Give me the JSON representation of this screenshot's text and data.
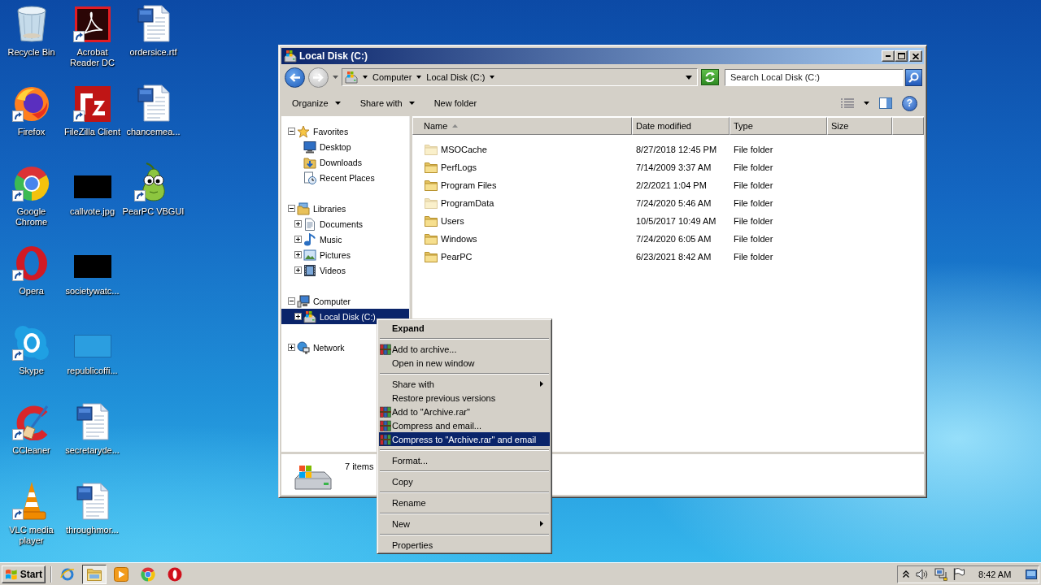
{
  "desktop": {
    "icons": [
      {
        "label": "Recycle Bin",
        "kind": "recycle-bin",
        "shortcut": false,
        "selected": false
      },
      {
        "label": "Firefox",
        "kind": "firefox",
        "shortcut": true,
        "selected": false
      },
      {
        "label": "Google Chrome",
        "kind": "chrome",
        "shortcut": true,
        "selected": false
      },
      {
        "label": "Opera",
        "kind": "opera",
        "shortcut": true,
        "selected": false
      },
      {
        "label": "Skype",
        "kind": "skype",
        "shortcut": true,
        "selected": false
      },
      {
        "label": "CCleaner",
        "kind": "ccleaner",
        "shortcut": true,
        "selected": false
      },
      {
        "label": "VLC media player",
        "kind": "vlc",
        "shortcut": true,
        "selected": false
      },
      {
        "label": "Acrobat Reader DC",
        "kind": "acrobat",
        "shortcut": true,
        "selected": false
      },
      {
        "label": "FileZilla Client",
        "kind": "filezilla",
        "shortcut": true,
        "selected": false
      },
      {
        "label": "callvote.jpg",
        "kind": "image-dark",
        "shortcut": false,
        "selected": false
      },
      {
        "label": "societywatc...",
        "kind": "image-dark",
        "shortcut": false,
        "selected": false
      },
      {
        "label": "republicoffi...",
        "kind": "image-blank",
        "shortcut": false,
        "selected": false
      },
      {
        "label": "secretaryde...",
        "kind": "word-doc",
        "shortcut": false,
        "selected": false
      },
      {
        "label": "throughmor...",
        "kind": "word-doc",
        "shortcut": false,
        "selected": false
      },
      {
        "label": "ordersice.rtf",
        "kind": "word-doc",
        "shortcut": false,
        "selected": false
      },
      {
        "label": "chancemea...",
        "kind": "word-doc",
        "shortcut": false,
        "selected": false
      },
      {
        "label": "PearPC VBGUI",
        "kind": "pear",
        "shortcut": true,
        "selected": false
      }
    ]
  },
  "window": {
    "title": "Local Disk (C:)",
    "navigation": {
      "back_disabled": false,
      "forward_disabled": true
    },
    "address": {
      "crumbs": [
        "Computer",
        "Local Disk (C:)"
      ]
    },
    "search": {
      "placeholder": "Search Local Disk (C:)"
    },
    "toolbar": {
      "buttons": [
        {
          "label": "Organize",
          "dropdown": true
        },
        {
          "label": "Share with",
          "dropdown": true
        },
        {
          "label": "New folder",
          "dropdown": false
        }
      ],
      "help_glyph": "?"
    },
    "nav_tree": [
      {
        "label": "Favorites",
        "kind": "favorites",
        "expanded": true,
        "selected": false,
        "children": [
          {
            "label": "Desktop",
            "kind": "desktop",
            "selected": false
          },
          {
            "label": "Downloads",
            "kind": "downloads",
            "selected": false
          },
          {
            "label": "Recent Places",
            "kind": "recent",
            "selected": false
          }
        ]
      },
      {
        "label": "Libraries",
        "kind": "libraries",
        "expanded": true,
        "selected": false,
        "children": [
          {
            "label": "Documents",
            "kind": "documents",
            "expanded": false,
            "selected": false
          },
          {
            "label": "Music",
            "kind": "music",
            "expanded": false,
            "selected": false
          },
          {
            "label": "Pictures",
            "kind": "pictures",
            "expanded": false,
            "selected": false
          },
          {
            "label": "Videos",
            "kind": "videos",
            "expanded": false,
            "selected": false
          }
        ]
      },
      {
        "label": "Computer",
        "kind": "computer",
        "expanded": true,
        "selected": false,
        "children": [
          {
            "label": "Local Disk (C:)",
            "kind": "drive",
            "expanded": false,
            "selected": true
          }
        ]
      },
      {
        "label": "Network",
        "kind": "network",
        "expanded": false,
        "selected": false
      }
    ],
    "table": {
      "columns": [
        {
          "label": "Name",
          "sorted": true
        },
        {
          "label": "Date modified",
          "sorted": false
        },
        {
          "label": "Type",
          "sorted": false
        },
        {
          "label": "Size",
          "sorted": false
        }
      ],
      "rows": [
        {
          "name": "MSOCache",
          "date_modified": "8/27/2018 12:45 PM",
          "type": "File folder",
          "hidden": true,
          "selected": false
        },
        {
          "name": "PerfLogs",
          "date_modified": "7/14/2009 3:37 AM",
          "type": "File folder",
          "hidden": false,
          "selected": false
        },
        {
          "name": "Program Files",
          "date_modified": "2/2/2021 1:04 PM",
          "type": "File folder",
          "hidden": false,
          "selected": false
        },
        {
          "name": "ProgramData",
          "date_modified": "7/24/2020 5:46 AM",
          "type": "File folder",
          "hidden": true,
          "selected": false
        },
        {
          "name": "Users",
          "date_modified": "10/5/2017 10:49 AM",
          "type": "File folder",
          "hidden": false,
          "selected": false
        },
        {
          "name": "Windows",
          "date_modified": "7/24/2020 6:05 AM",
          "type": "File folder",
          "hidden": false,
          "selected": false
        },
        {
          "name": "PearPC",
          "date_modified": "6/23/2021 8:42 AM",
          "type": "File folder",
          "hidden": false,
          "selected": false
        }
      ]
    },
    "status_bar": {
      "item_count": "7 items"
    }
  },
  "context_menu": {
    "items": [
      {
        "kind": "command",
        "label": "Expand",
        "default": true,
        "submenu": false,
        "selected": false
      },
      {
        "kind": "separator"
      },
      {
        "kind": "archiver",
        "label": "Add to archive...",
        "default": false,
        "submenu": false,
        "selected": false
      },
      {
        "kind": "command",
        "label": "Open in new window",
        "default": false,
        "submenu": false,
        "selected": false
      },
      {
        "kind": "separator"
      },
      {
        "kind": "command",
        "label": "Share with",
        "default": false,
        "submenu": true,
        "selected": false
      },
      {
        "kind": "command",
        "label": "Restore previous versions",
        "default": false,
        "submenu": false,
        "selected": false
      },
      {
        "kind": "archiver",
        "label": "Add to \"Archive.rar\"",
        "default": false,
        "submenu": false,
        "selected": false
      },
      {
        "kind": "archiver",
        "label": "Compress and email...",
        "default": false,
        "submenu": false,
        "selected": false
      },
      {
        "kind": "archiver",
        "label": "Compress to \"Archive.rar\" and email",
        "default": false,
        "submenu": false,
        "selected": true
      },
      {
        "kind": "separator"
      },
      {
        "kind": "command",
        "label": "Format...",
        "default": false,
        "submenu": false,
        "selected": false
      },
      {
        "kind": "separator"
      },
      {
        "kind": "command",
        "label": "Copy",
        "default": false,
        "submenu": false,
        "selected": false
      },
      {
        "kind": "separator"
      },
      {
        "kind": "command",
        "label": "Rename",
        "default": false,
        "submenu": false,
        "selected": false
      },
      {
        "kind": "separator"
      },
      {
        "kind": "command",
        "label": "New",
        "default": false,
        "submenu": true,
        "selected": false
      },
      {
        "kind": "separator"
      },
      {
        "kind": "command",
        "label": "Properties",
        "default": false,
        "submenu": false,
        "selected": false
      }
    ]
  },
  "taskbar": {
    "start_label": "Start",
    "apps": [
      {
        "kind": "ie",
        "active": false
      },
      {
        "kind": "explorer",
        "active": true
      },
      {
        "kind": "media",
        "active": false
      },
      {
        "kind": "chrome",
        "active": false
      },
      {
        "kind": "ring",
        "active": false
      }
    ],
    "clock": "8:42 AM"
  }
}
